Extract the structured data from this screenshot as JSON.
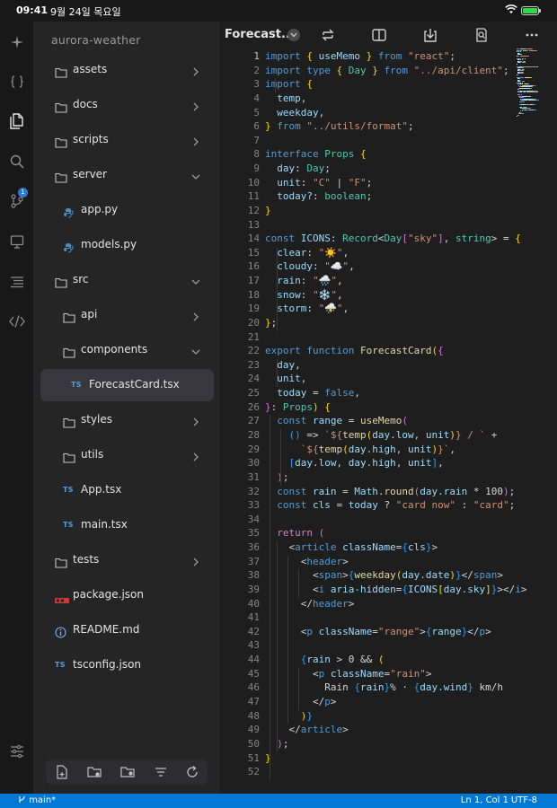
{
  "status_bar": {
    "time": "09:41",
    "date": "9월 24일 목요일",
    "battery_level": 1.0
  },
  "activity_bar": {
    "icons": [
      "sparkle-icon",
      "braces-icon",
      "files-icon",
      "search-icon",
      "source-control-icon",
      "monitor-icon",
      "list-icon",
      "code-icon"
    ],
    "source_control_badge": "1"
  },
  "sidebar": {
    "project": "aurora-weather",
    "items": [
      {
        "label": "assets",
        "kind": "folder",
        "depth": 0,
        "chevron": "right"
      },
      {
        "label": "docs",
        "kind": "folder",
        "depth": 0,
        "chevron": "right"
      },
      {
        "label": "scripts",
        "kind": "folder",
        "depth": 0,
        "chevron": "right"
      },
      {
        "label": "server",
        "kind": "folder",
        "depth": 0,
        "chevron": "down"
      },
      {
        "label": "app.py",
        "kind": "python",
        "depth": 1
      },
      {
        "label": "models.py",
        "kind": "python",
        "depth": 1
      },
      {
        "label": "src",
        "kind": "folder",
        "depth": 0,
        "chevron": "down"
      },
      {
        "label": "api",
        "kind": "folder",
        "depth": 1,
        "chevron": "right"
      },
      {
        "label": "components",
        "kind": "folder",
        "depth": 1,
        "chevron": "down"
      },
      {
        "label": "ForecastCard.tsx",
        "kind": "ts",
        "depth": 2,
        "selected": true
      },
      {
        "label": "styles",
        "kind": "folder",
        "depth": 1,
        "chevron": "right"
      },
      {
        "label": "utils",
        "kind": "folder",
        "depth": 1,
        "chevron": "right"
      },
      {
        "label": "App.tsx",
        "kind": "ts",
        "depth": 1
      },
      {
        "label": "main.tsx",
        "kind": "ts",
        "depth": 1
      },
      {
        "label": "tests",
        "kind": "folder",
        "depth": 0,
        "chevron": "right"
      },
      {
        "label": "package.json",
        "kind": "npm",
        "depth": 0
      },
      {
        "label": "README.md",
        "kind": "info",
        "depth": 0
      },
      {
        "label": "tsconfig.json",
        "kind": "ts",
        "depth": 0
      }
    ],
    "ts_tag": "TS",
    "toolbar_icons": [
      "new-file-icon",
      "new-folder-icon",
      "folder-settings-icon",
      "sort-icon",
      "refresh-icon"
    ]
  },
  "editor": {
    "tab_title": "Forecast...",
    "toolbar_icons": [
      "swap-icon",
      "split-view-icon",
      "download-icon",
      "find-icon",
      "more-icon"
    ],
    "current_line": 1,
    "lines": [
      [
        [
          "k",
          "import"
        ],
        [
          "p",
          " "
        ],
        [
          "br1",
          "{"
        ],
        [
          "v",
          " useMemo "
        ],
        [
          "br1",
          "}"
        ],
        [
          "k",
          " from"
        ],
        [
          "s",
          " \"react\""
        ],
        [
          "p",
          ";"
        ]
      ],
      [
        [
          "k",
          "import type"
        ],
        [
          "p",
          " "
        ],
        [
          "br1",
          "{"
        ],
        [
          "t",
          " Day "
        ],
        [
          "br1",
          "}"
        ],
        [
          "k",
          " from"
        ],
        [
          "s",
          " \"../api/client\""
        ],
        [
          "p",
          ";"
        ]
      ],
      [
        [
          "k",
          "import"
        ],
        [
          "p",
          " "
        ],
        [
          "br1",
          "{"
        ]
      ],
      [
        [
          "v",
          "  temp"
        ],
        [
          "p",
          ","
        ]
      ],
      [
        [
          "v",
          "  weekday"
        ],
        [
          "p",
          ","
        ]
      ],
      [
        [
          "br1",
          "}"
        ],
        [
          "k",
          " from"
        ],
        [
          "s",
          " \"../utils/format\""
        ],
        [
          "p",
          ";"
        ]
      ],
      [],
      [
        [
          "k",
          "interface"
        ],
        [
          "t",
          " Props"
        ],
        [
          "p",
          " "
        ],
        [
          "br1",
          "{"
        ]
      ],
      [
        [
          "v",
          "  day"
        ],
        [
          "p",
          ": "
        ],
        [
          "t",
          "Day"
        ],
        [
          "p",
          ";"
        ]
      ],
      [
        [
          "v",
          "  unit"
        ],
        [
          "p",
          ": "
        ],
        [
          "s",
          "\"C\""
        ],
        [
          "p",
          " | "
        ],
        [
          "s",
          "\"F\""
        ],
        [
          "p",
          ";"
        ]
      ],
      [
        [
          "v",
          "  today?"
        ],
        [
          "p",
          ": "
        ],
        [
          "t",
          "boolean"
        ],
        [
          "p",
          ";"
        ]
      ],
      [
        [
          "br1",
          "}"
        ]
      ],
      [],
      [
        [
          "k",
          "const"
        ],
        [
          "v",
          " ICONS"
        ],
        [
          "p",
          ": "
        ],
        [
          "t",
          "Record"
        ],
        [
          "p",
          "<"
        ],
        [
          "t",
          "Day"
        ],
        [
          "br2",
          "["
        ],
        [
          "s",
          "\"sky\""
        ],
        [
          "br2",
          "]"
        ],
        [
          "p",
          ", "
        ],
        [
          "t",
          "string"
        ],
        [
          "p",
          "> = "
        ],
        [
          "br1",
          "{"
        ]
      ],
      [
        [
          "v",
          "  clear"
        ],
        [
          "p",
          ": "
        ],
        [
          "s",
          "\"☀️\""
        ],
        [
          "p",
          ","
        ]
      ],
      [
        [
          "v",
          "  cloudy"
        ],
        [
          "p",
          ": "
        ],
        [
          "s",
          "\"☁️\""
        ],
        [
          "p",
          ","
        ]
      ],
      [
        [
          "v",
          "  rain"
        ],
        [
          "p",
          ": "
        ],
        [
          "s",
          "\"🌧️\""
        ],
        [
          "p",
          ","
        ]
      ],
      [
        [
          "v",
          "  snow"
        ],
        [
          "p",
          ": "
        ],
        [
          "s",
          "\"❄️\""
        ],
        [
          "p",
          ","
        ]
      ],
      [
        [
          "v",
          "  storm"
        ],
        [
          "p",
          ": "
        ],
        [
          "s",
          "\"⛈️\""
        ],
        [
          "p",
          ","
        ]
      ],
      [
        [
          "br1",
          "}"
        ],
        [
          "p",
          ";"
        ]
      ],
      [],
      [
        [
          "k",
          "export function"
        ],
        [
          "f",
          " ForecastCard"
        ],
        [
          "br1",
          "("
        ],
        [
          "br2",
          "{"
        ]
      ],
      [
        [
          "v",
          "  day"
        ],
        [
          "p",
          ","
        ]
      ],
      [
        [
          "v",
          "  unit"
        ],
        [
          "p",
          ","
        ]
      ],
      [
        [
          "v",
          "  today"
        ],
        [
          "p",
          " = "
        ],
        [
          "k",
          "false"
        ],
        [
          "p",
          ","
        ]
      ],
      [
        [
          "br2",
          "}"
        ],
        [
          "p",
          ": "
        ],
        [
          "t",
          "Props"
        ],
        [
          "br1",
          ")"
        ],
        [
          "p",
          " "
        ],
        [
          "br1",
          "{"
        ]
      ],
      [
        [
          "k",
          "  const"
        ],
        [
          "v",
          " range"
        ],
        [
          "p",
          " = "
        ],
        [
          "f",
          "useMemo"
        ],
        [
          "br2",
          "("
        ]
      ],
      [
        [
          "br3",
          "    ()"
        ],
        [
          "p",
          " => "
        ],
        [
          "s",
          "`${"
        ],
        [
          "f",
          "temp"
        ],
        [
          "br1",
          "("
        ],
        [
          "v",
          "day.low, unit"
        ],
        [
          "br1",
          ")"
        ],
        [
          "s",
          "} / `"
        ],
        [
          "p",
          " +"
        ]
      ],
      [
        [
          "s",
          "      `${"
        ],
        [
          "f",
          "temp"
        ],
        [
          "br1",
          "("
        ],
        [
          "v",
          "day.high, unit"
        ],
        [
          "br1",
          ")"
        ],
        [
          "s",
          "}`"
        ],
        [
          "p",
          ","
        ]
      ],
      [
        [
          "br3",
          "    ["
        ],
        [
          "v",
          "day.low, day.high, unit"
        ],
        [
          "br3",
          "]"
        ],
        [
          "p",
          ","
        ]
      ],
      [
        [
          "br2",
          "  )"
        ],
        [
          "p",
          ";"
        ]
      ],
      [
        [
          "k",
          "  const"
        ],
        [
          "v",
          " rain"
        ],
        [
          "p",
          " = "
        ],
        [
          "v",
          "Math"
        ],
        [
          "p",
          "."
        ],
        [
          "f",
          "round"
        ],
        [
          "br2",
          "("
        ],
        [
          "v",
          "day.rain"
        ],
        [
          "p",
          " * "
        ],
        [
          "p",
          "100"
        ],
        [
          "br2",
          ")"
        ],
        [
          "p",
          ";"
        ]
      ],
      [
        [
          "k",
          "  const"
        ],
        [
          "v",
          " cls"
        ],
        [
          "p",
          " = "
        ],
        [
          "v",
          "today"
        ],
        [
          "p",
          " ? "
        ],
        [
          "s",
          "\"card now\""
        ],
        [
          "p",
          " : "
        ],
        [
          "s",
          "\"card\""
        ],
        [
          "p",
          ";"
        ]
      ],
      [],
      [
        [
          "kc",
          "  return"
        ],
        [
          "p",
          " "
        ],
        [
          "br2",
          "("
        ]
      ],
      [
        [
          "p",
          "    <"
        ],
        [
          "tg",
          "article"
        ],
        [
          "at",
          " className"
        ],
        [
          "p",
          "="
        ],
        [
          "br3",
          "{"
        ],
        [
          "v",
          "cls"
        ],
        [
          "br3",
          "}"
        ],
        [
          "p",
          ">"
        ]
      ],
      [
        [
          "p",
          "      <"
        ],
        [
          "tg",
          "header"
        ],
        [
          "p",
          ">"
        ]
      ],
      [
        [
          "p",
          "        <"
        ],
        [
          "tg",
          "span"
        ],
        [
          "p",
          ">"
        ],
        [
          "br3",
          "{"
        ],
        [
          "f",
          "weekday"
        ],
        [
          "br1",
          "("
        ],
        [
          "v",
          "day.date"
        ],
        [
          "br1",
          ")"
        ],
        [
          "br3",
          "}"
        ],
        [
          "p",
          "</"
        ],
        [
          "tg",
          "span"
        ],
        [
          "p",
          ">"
        ]
      ],
      [
        [
          "p",
          "        <"
        ],
        [
          "tg",
          "i"
        ],
        [
          "at",
          " aria-hidden"
        ],
        [
          "p",
          "="
        ],
        [
          "br3",
          "{"
        ],
        [
          "v",
          "ICONS"
        ],
        [
          "br1",
          "["
        ],
        [
          "v",
          "day.sky"
        ],
        [
          "br1",
          "]"
        ],
        [
          "br3",
          "}"
        ],
        [
          "p",
          "></"
        ],
        [
          "tg",
          "i"
        ],
        [
          "p",
          ">"
        ]
      ],
      [
        [
          "p",
          "      </"
        ],
        [
          "tg",
          "header"
        ],
        [
          "p",
          ">"
        ]
      ],
      [],
      [
        [
          "p",
          "      <"
        ],
        [
          "tg",
          "p"
        ],
        [
          "at",
          " className"
        ],
        [
          "p",
          "="
        ],
        [
          "s",
          "\"range\""
        ],
        [
          "p",
          ">"
        ],
        [
          "br3",
          "{"
        ],
        [
          "v",
          "range"
        ],
        [
          "br3",
          "}"
        ],
        [
          "p",
          "</"
        ],
        [
          "tg",
          "p"
        ],
        [
          "p",
          ">"
        ]
      ],
      [],
      [
        [
          "br3",
          "      {"
        ],
        [
          "v",
          "rain"
        ],
        [
          "p",
          " > 0 && "
        ],
        [
          "br1",
          "("
        ]
      ],
      [
        [
          "p",
          "        <"
        ],
        [
          "tg",
          "p"
        ],
        [
          "at",
          " className"
        ],
        [
          "p",
          "="
        ],
        [
          "s",
          "\"rain\""
        ],
        [
          "p",
          ">"
        ]
      ],
      [
        [
          "p",
          "          Rain "
        ],
        [
          "br3",
          "{"
        ],
        [
          "v",
          "rain"
        ],
        [
          "br3",
          "}"
        ],
        [
          "p",
          "% · "
        ],
        [
          "br3",
          "{"
        ],
        [
          "v",
          "day.wind"
        ],
        [
          "br3",
          "}"
        ],
        [
          "p",
          " km/h"
        ]
      ],
      [
        [
          "p",
          "        </"
        ],
        [
          "tg",
          "p"
        ],
        [
          "p",
          ">"
        ]
      ],
      [
        [
          "br1",
          "      )"
        ],
        [
          "br3",
          "}"
        ]
      ],
      [
        [
          "p",
          "    </"
        ],
        [
          "tg",
          "article"
        ],
        [
          "p",
          ">"
        ]
      ],
      [
        [
          "br2",
          "  )"
        ],
        [
          "p",
          ";"
        ]
      ],
      [
        [
          "br1",
          "}"
        ]
      ],
      []
    ]
  },
  "footer": {
    "branch": "main*",
    "position": "Ln 1, Col 1",
    "encoding": "UTF-8"
  }
}
